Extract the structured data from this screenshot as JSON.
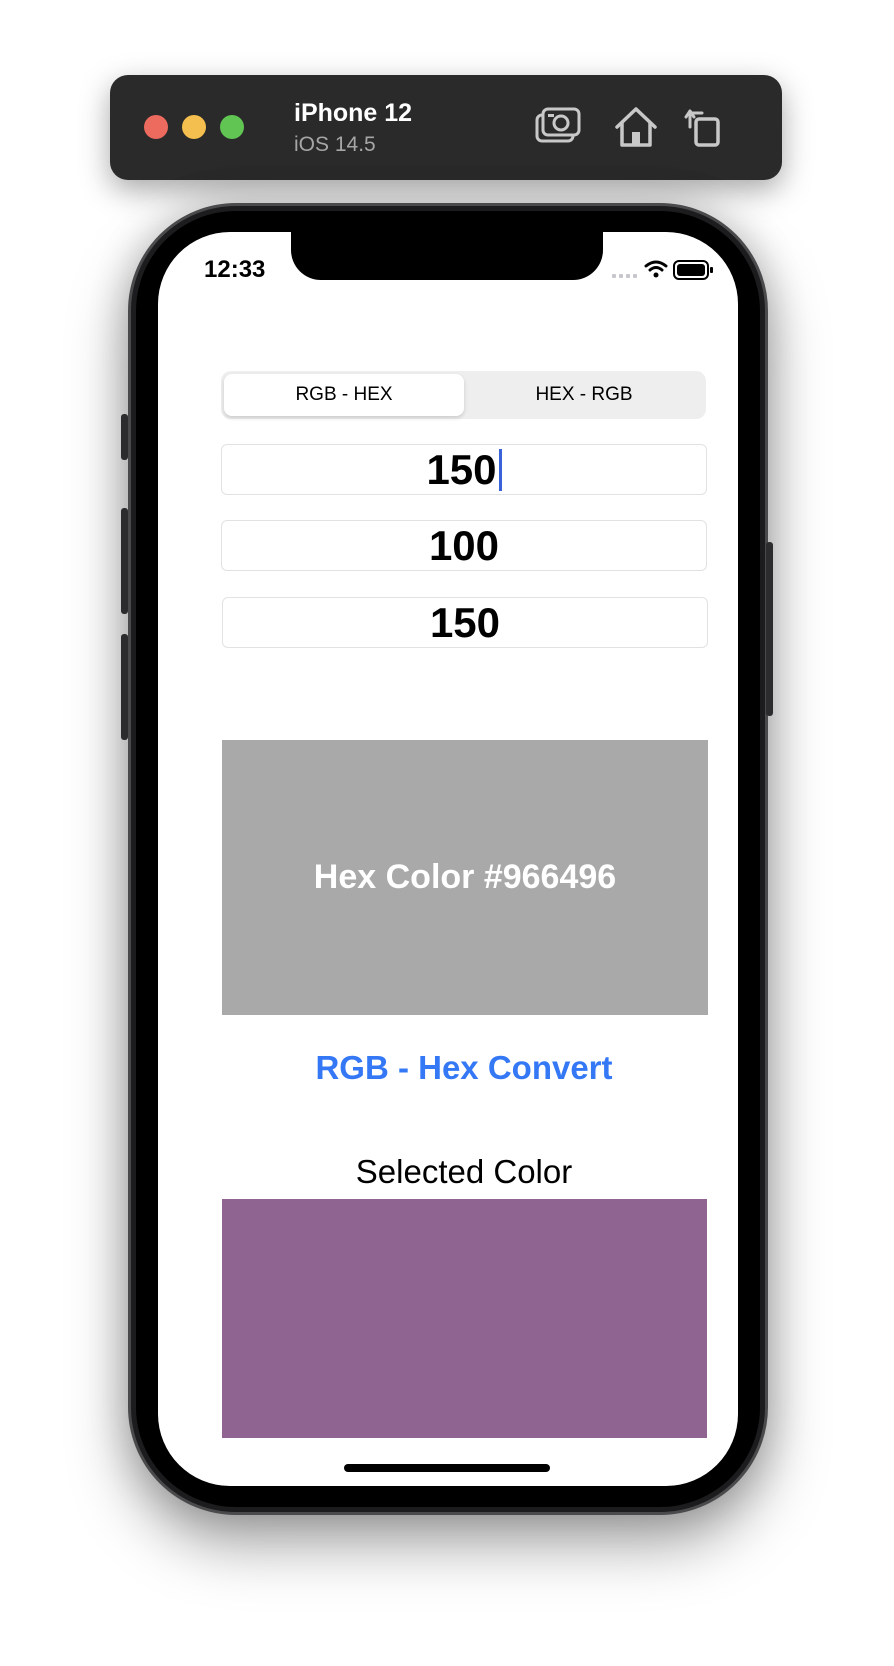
{
  "simulator": {
    "device_name": "iPhone 12",
    "os_version": "iOS 14.5",
    "buttons": [
      "screenshot-icon",
      "home-icon",
      "rotate-icon"
    ],
    "traffic_lights": [
      "#ed6a5e",
      "#f5bf4f",
      "#61c554"
    ]
  },
  "status_bar": {
    "time": "12:33"
  },
  "segmented_control": {
    "options": [
      "RGB - HEX",
      "HEX - RGB"
    ],
    "selected": "RGB - HEX"
  },
  "inputs": {
    "red": "150",
    "green": "100",
    "blue": "150"
  },
  "hex_display": {
    "label": "Hex Color #966496",
    "background": "#a9a9a9"
  },
  "convert_button": {
    "label": "RGB - Hex Convert",
    "color": "#3478f6"
  },
  "selected_color": {
    "label": "Selected Color",
    "color": "#8f6491"
  }
}
